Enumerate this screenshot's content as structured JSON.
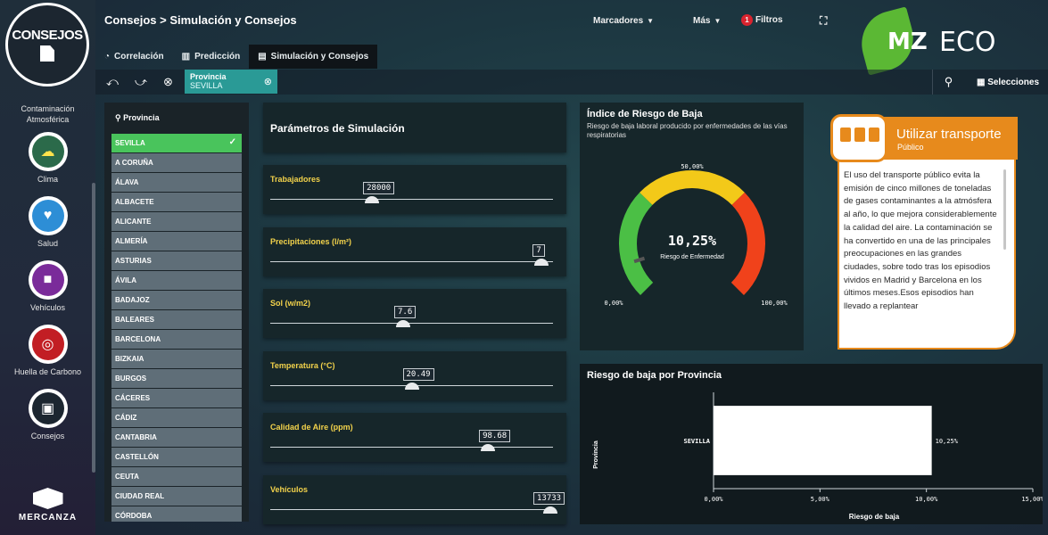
{
  "app": {
    "logo_text": "CONSEJOS",
    "brand": "MERCANZA",
    "eco_mz": "MZ",
    "eco_txt": "ECO"
  },
  "rail": {
    "items": [
      {
        "label": "Contaminación\nAtmosférica",
        "icon": "pollution-icon"
      },
      {
        "label": "Clima",
        "icon": "weather-icon",
        "color": "#2b6a4a"
      },
      {
        "label": "Salud",
        "icon": "heart-icon",
        "color": "#2d8ed6"
      },
      {
        "label": "Vehículos",
        "icon": "truck-icon",
        "color": "#7a2b9a"
      },
      {
        "label": "Huella de Carbono",
        "icon": "footprint-icon",
        "color": "#c21e24"
      },
      {
        "label": "Consejos",
        "icon": "advice-icon",
        "color": "#1c2630"
      }
    ]
  },
  "header": {
    "breadcrumb": "Consejos > Simulación y Consejos",
    "bookmarks": "Marcadores",
    "more": "Más",
    "filters_count": "1",
    "filters": "Filtros"
  },
  "tabs": [
    {
      "label": "Correlación",
      "icon": "gauge-icon",
      "active": false
    },
    {
      "label": "Predicción",
      "icon": "barchart-icon",
      "active": false
    },
    {
      "label": "Simulación y Consejos",
      "icon": "box-icon",
      "active": true
    }
  ],
  "selection": {
    "field": "Provincia",
    "value": "SEVILLA",
    "selections_label": "Selecciones"
  },
  "province_list": {
    "header": "Provincia",
    "items": [
      "SEVILLA",
      "A CORUÑA",
      "ÁLAVA",
      "ALBACETE",
      "ALICANTE",
      "ALMERÍA",
      "ASTURIAS",
      "ÁVILA",
      "BADAJOZ",
      "BALEARES",
      "BARCELONA",
      "BIZKAIA",
      "BURGOS",
      "CÁCERES",
      "CÁDIZ",
      "CANTABRIA",
      "CASTELLÓN",
      "CEUTA",
      "CIUDAD REAL",
      "CÓRDOBA"
    ],
    "selected": "SEVILLA"
  },
  "simulation": {
    "title": "Parámetros de Simulación",
    "sliders": [
      {
        "label": "Trabajadores",
        "value": "28000",
        "fraction": 0.36
      },
      {
        "label": "Precipitaciones (l/m²)",
        "value": "7",
        "fraction": 0.96
      },
      {
        "label": "Sol (w/m2)",
        "value": "7.6",
        "fraction": 0.47
      },
      {
        "label": "Temperatura (°C)",
        "value": "20.49",
        "fraction": 0.5
      },
      {
        "label": "Calidad de Aire (ppm)",
        "value": "98.68",
        "fraction": 0.77
      },
      {
        "label": "Vehículos",
        "value": "13733",
        "fraction": 0.99
      }
    ]
  },
  "gauge": {
    "title": "Índice de Riesgo de Baja",
    "subtitle": "Riesgo de baja laboral producido por enfermedades de las vías respiratorias",
    "value_text": "10,25%",
    "value": 10.25,
    "value_label": "Riesgo de Enfermedad",
    "min_label": "0,00%",
    "mid_label": "50,00%",
    "max_label": "100,00%",
    "colors": {
      "low": "#4bbf45",
      "mid": "#f3c919",
      "high": "#f0421b"
    }
  },
  "tip": {
    "title": "Utilizar transporte",
    "subtitle": "Público",
    "body": "El uso del transporte público evita la emisión de cinco millones de toneladas de gases contaminantes a la atmósfera al año, lo que mejora considerablemente la calidad del aire. La contaminación se ha convertido en una de las principales preocupaciones en las grandes ciudades, sobre todo tras los episodios vividos en Madrid y Barcelona en los últimos meses.Esos episodios han llevado a replantear",
    "accent": "#e78a1c"
  },
  "chart_data": {
    "type": "bar",
    "orientation": "horizontal",
    "title": "Riesgo de baja por Provincia",
    "categories": [
      "SEVILLA"
    ],
    "values": [
      10.25
    ],
    "value_labels": [
      "10,25%"
    ],
    "xlabel": "Riesgo de baja",
    "ylabel": "Provincia",
    "xlim": [
      0,
      15
    ],
    "xticks": [
      "0,00%",
      "5,00%",
      "10,00%",
      "15,00%"
    ],
    "grid": false
  }
}
